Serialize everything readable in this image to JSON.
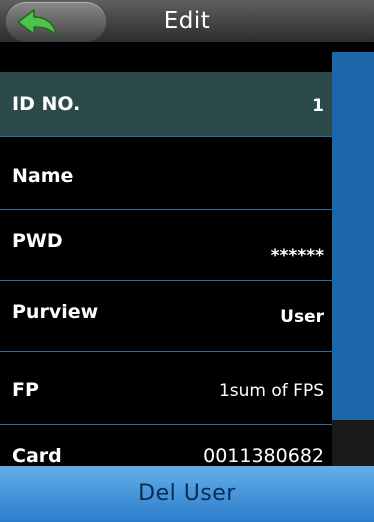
{
  "header": {
    "title": "Edit",
    "back_icon": "back-arrow-icon"
  },
  "fields": [
    {
      "label": "ID NO.",
      "value": "1"
    },
    {
      "label": "Name",
      "value": ""
    },
    {
      "label": "PWD",
      "value": "******"
    },
    {
      "label": "Purview",
      "value": "User"
    },
    {
      "label": "FP",
      "value": "1sum of FPS"
    },
    {
      "label": "Card",
      "value": "0011380682"
    }
  ],
  "footer": {
    "button_label": "Del User"
  },
  "colors": {
    "accent": "#1b67aa",
    "selected_row": "#2c4a4a",
    "footer": "#4a98dd"
  }
}
